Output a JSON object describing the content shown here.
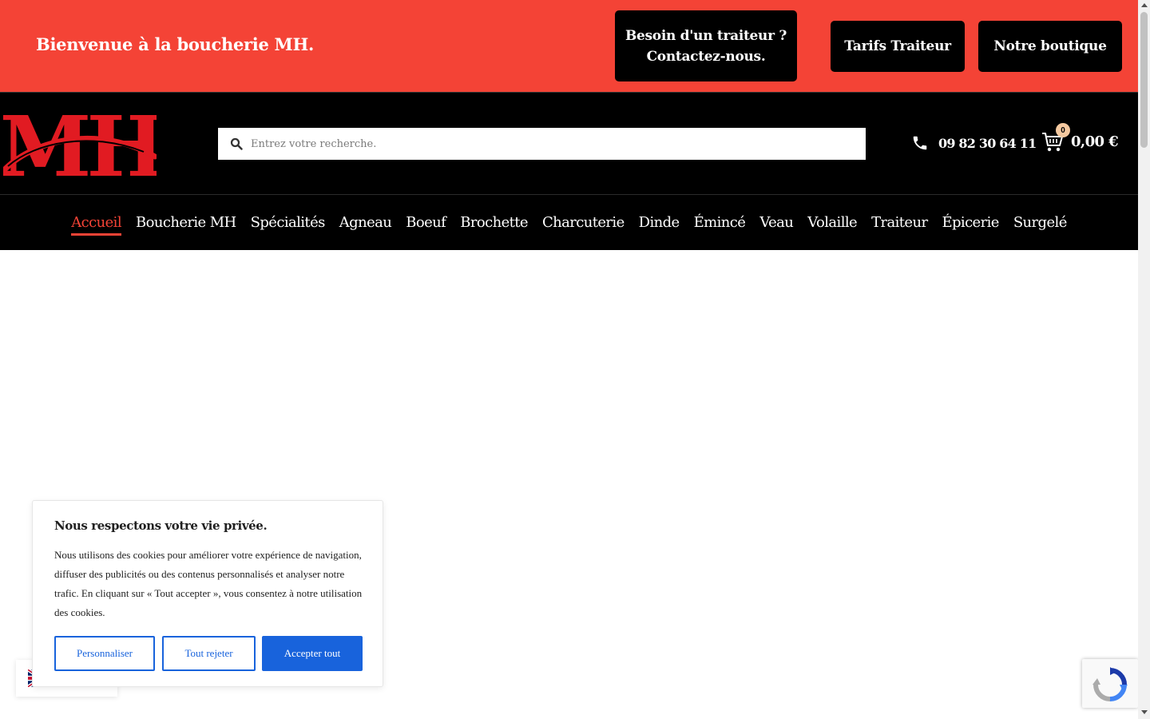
{
  "topbar": {
    "welcome": "Bienvenue à la boucherie MH.",
    "traiteur_line1": "Besoin d'un traiteur ?",
    "traiteur_line2": "Contactez-nous.",
    "tarifs_label": "Tarifs Traiteur",
    "boutique_label": "Notre boutique"
  },
  "header": {
    "logo_text": "MH",
    "search_placeholder": "Entrez votre recherche.",
    "phone": "09 82 30 64 11",
    "cart_count": "0",
    "cart_total": "0,00 €"
  },
  "nav": {
    "items": [
      {
        "label": "Accueil",
        "active": true
      },
      {
        "label": "Boucherie MH"
      },
      {
        "label": "Spécialités"
      },
      {
        "label": "Agneau"
      },
      {
        "label": "Boeuf"
      },
      {
        "label": "Brochette"
      },
      {
        "label": "Charcuterie"
      },
      {
        "label": "Dinde"
      },
      {
        "label": "Émincé"
      },
      {
        "label": "Veau"
      },
      {
        "label": "Volaille"
      },
      {
        "label": "Traiteur"
      },
      {
        "label": "Épicerie"
      },
      {
        "label": "Surgelé"
      }
    ]
  },
  "cookie": {
    "title": "Nous respectons votre vie privée.",
    "text": "Nous utilisons des cookies pour améliorer votre expérience de navigation, diffuser des publicités ou des contenus personnalisés et analyser notre trafic. En cliquant sur « Tout accepter », vous consentez à notre utilisation des cookies.",
    "customize_label": "Personnaliser",
    "reject_label": "Tout rejeter",
    "accept_label": "Accepter tout"
  },
  "colors": {
    "brand_red": "#f44336",
    "header_black": "#000000",
    "cookie_blue": "#1863dc"
  },
  "icons": {
    "search": "search-icon",
    "phone": "phone-icon",
    "cart": "cart-icon",
    "flag": "uk-flag-icon",
    "recaptcha": "recaptcha-icon"
  }
}
